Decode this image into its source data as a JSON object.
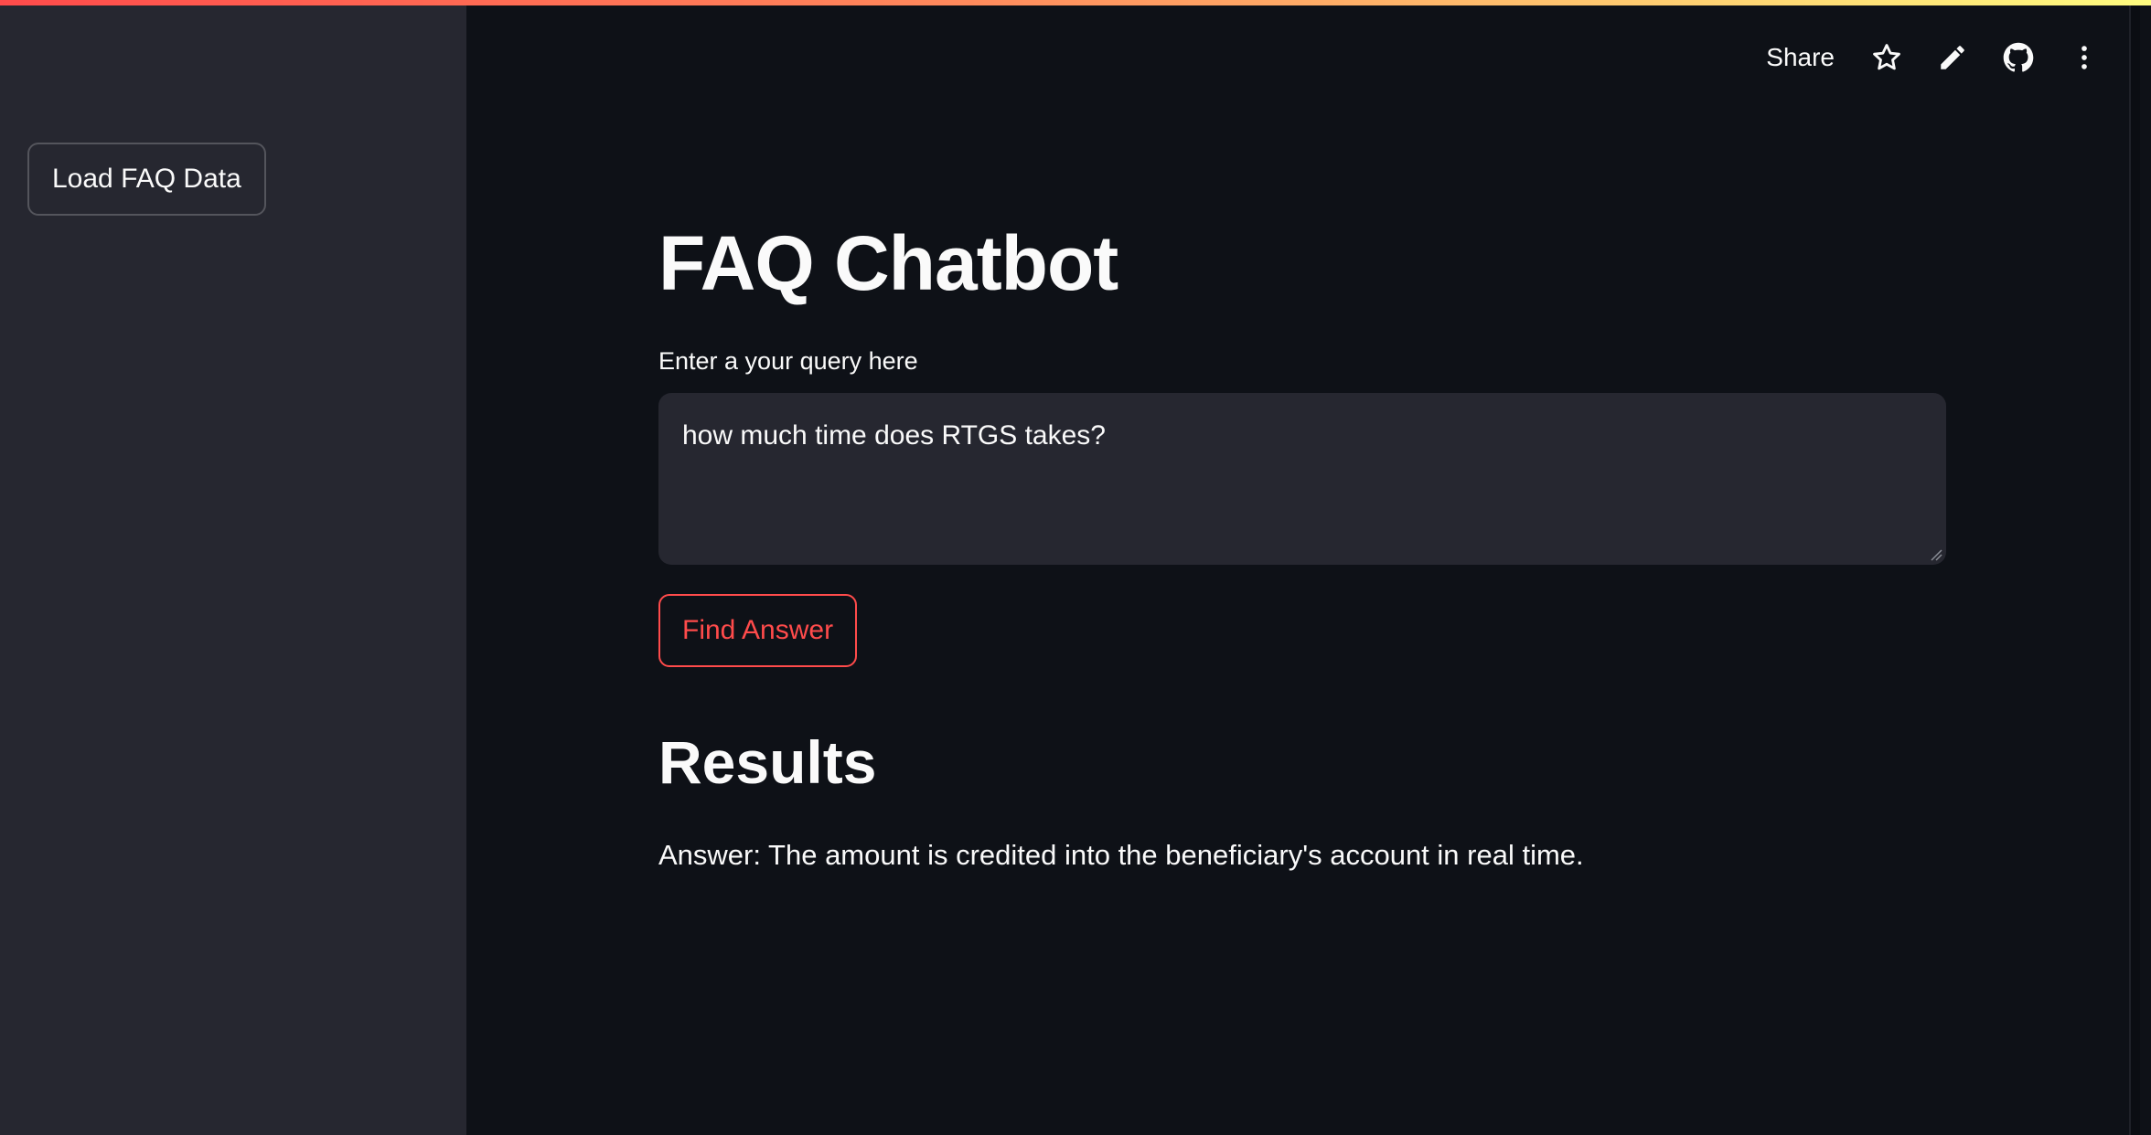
{
  "sidebar": {
    "load_button_label": "Load FAQ Data"
  },
  "toolbar": {
    "share_label": "Share",
    "icons": [
      "star-icon",
      "pencil-icon",
      "github-icon",
      "more-vertical-icon"
    ]
  },
  "main": {
    "title": "FAQ Chatbot",
    "query_label": "Enter a your query here",
    "query_value": "how much time does RTGS takes?",
    "find_button_label": "Find Answer",
    "results_heading": "Results",
    "answer_text": "Answer: The amount is credited into the beneficiary's account in real time."
  },
  "colors": {
    "background": "#0e1117",
    "sidebar": "#262730",
    "accent": "#ff4b4b",
    "text": "#fafafa"
  }
}
